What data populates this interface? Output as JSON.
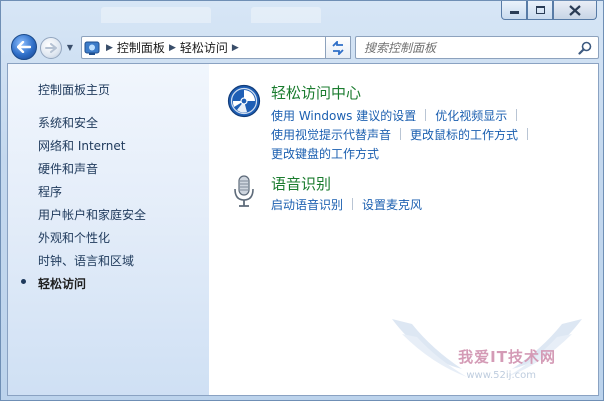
{
  "navigation": {
    "breadcrumbs": [
      "控制面板",
      "轻松访问"
    ]
  },
  "search": {
    "placeholder": "搜索控制面板"
  },
  "sidebar": {
    "home_label": "控制面板主页",
    "items": [
      {
        "label": "系统和安全"
      },
      {
        "label": "网络和 Internet"
      },
      {
        "label": "硬件和声音"
      },
      {
        "label": "程序"
      },
      {
        "label": "用户帐户和家庭安全"
      },
      {
        "label": "外观和个性化"
      },
      {
        "label": "时钟、语言和区域"
      },
      {
        "label": "轻松访问"
      }
    ]
  },
  "main": {
    "ease_center": {
      "title": "轻松访问中心",
      "links": [
        "使用 Windows 建议的设置",
        "优化视频显示",
        "使用视觉提示代替声音",
        "更改鼠标的工作方式",
        "更改键盘的工作方式"
      ],
      "icon": "ease-of-access-icon"
    },
    "speech": {
      "title": "语音识别",
      "links": [
        "启动语音识别",
        "设置麦克风"
      ],
      "icon": "microphone-icon"
    }
  },
  "watermark": {
    "text": "我爱IT技术网",
    "sub": "www.52ij.com"
  },
  "colors": {
    "category_title": "#1b7c2f",
    "link": "#1b5fb0",
    "sidebar_text": "#1e395b"
  }
}
